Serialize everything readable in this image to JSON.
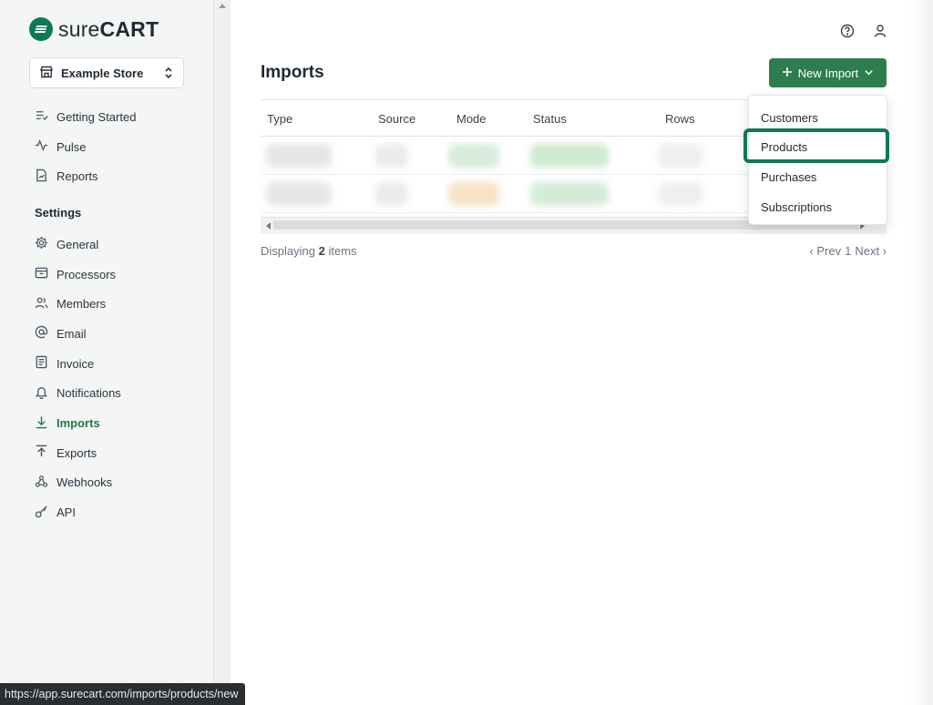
{
  "brand": {
    "name_light": "sure",
    "name_bold": "CART",
    "accent": "#2f7d4f"
  },
  "store": {
    "name": "Example Store"
  },
  "nav": {
    "top": [
      {
        "label": "Getting Started",
        "icon": "list-check-icon"
      },
      {
        "label": "Pulse",
        "icon": "activity-icon"
      },
      {
        "label": "Reports",
        "icon": "report-file-icon"
      }
    ],
    "settings_heading": "Settings",
    "settings": [
      {
        "label": "General",
        "icon": "gear-icon"
      },
      {
        "label": "Processors",
        "icon": "inbox-icon"
      },
      {
        "label": "Members",
        "icon": "users-icon"
      },
      {
        "label": "Email",
        "icon": "at-sign-icon"
      },
      {
        "label": "Invoice",
        "icon": "file-text-icon"
      },
      {
        "label": "Notifications",
        "icon": "bell-icon"
      },
      {
        "label": "Imports",
        "icon": "download-arrow-icon",
        "active": true
      },
      {
        "label": "Exports",
        "icon": "upload-arrow-icon"
      },
      {
        "label": "Webhooks",
        "icon": "webhook-icon"
      },
      {
        "label": "API",
        "icon": "key-icon"
      }
    ]
  },
  "page": {
    "title": "Imports",
    "new_button": "New Import"
  },
  "table": {
    "columns": [
      "Type",
      "Source",
      "Mode",
      "Status",
      "Rows"
    ]
  },
  "footer": {
    "displaying_prefix": "Displaying",
    "count": "2",
    "displaying_suffix": "items",
    "prev": "‹ Prev",
    "page": "1",
    "next": "Next ›"
  },
  "dropdown": {
    "items": [
      "Customers",
      "Products",
      "Purchases",
      "Subscriptions"
    ],
    "highlighted": "Products"
  },
  "status_bar": {
    "url": "https://app.surecart.com/imports/products/new"
  }
}
